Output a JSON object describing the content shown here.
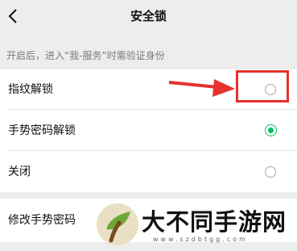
{
  "nav": {
    "title": "安全锁",
    "back_icon": "chevron-left-icon"
  },
  "hint": "开启后，进入“我-服务”时需验证身份",
  "options": [
    {
      "label": "指纹解锁",
      "selected": false
    },
    {
      "label": "手势密码解锁",
      "selected": true
    },
    {
      "label": "关闭",
      "selected": false
    }
  ],
  "change_gesture": {
    "label": "修改手势密码"
  },
  "annotation": {
    "color": "#e4322c"
  },
  "watermark": {
    "text": "大不同手游网",
    "url": "www.szdbtgg.com"
  },
  "colors": {
    "accent": "#07c160",
    "background": "#ededed"
  }
}
